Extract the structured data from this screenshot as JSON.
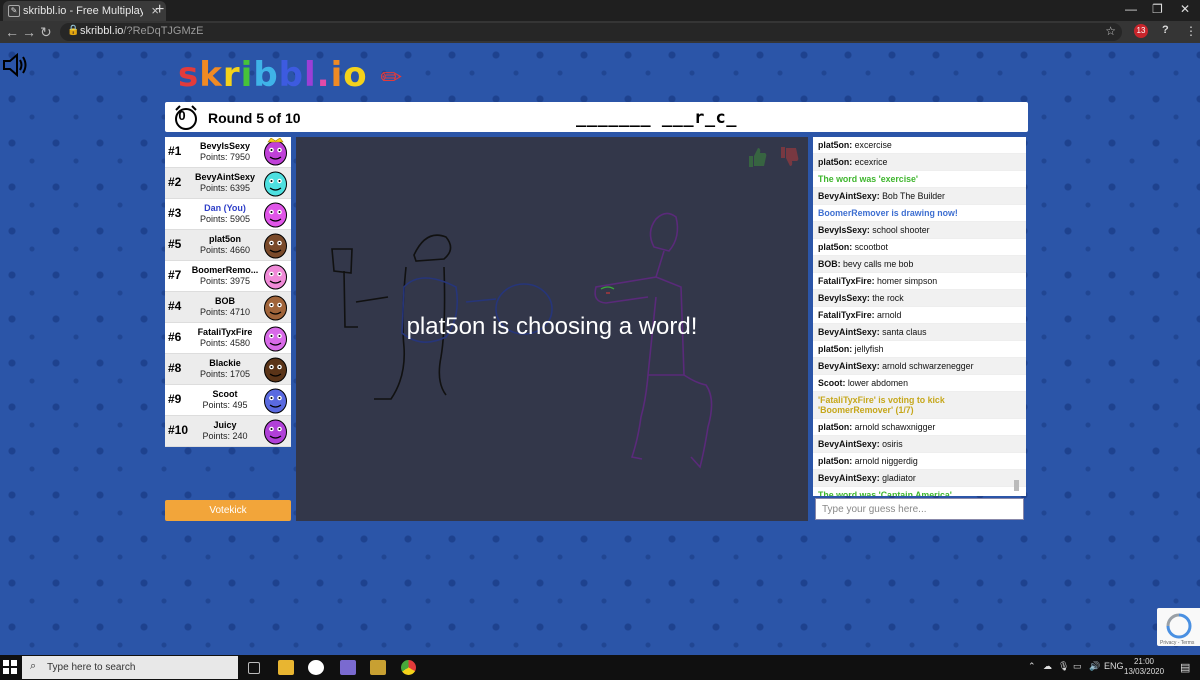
{
  "browser": {
    "tab_title": "skribbl.io - Free Multiplayer Drawi",
    "url_host": "skribbl.io",
    "url_path": "/?ReDqTJGMzE",
    "ext_badge": "13"
  },
  "game": {
    "logo": "skribbl.io",
    "timer": "0",
    "round": "Round 5 of 10",
    "hint": "_______ ___r_c_",
    "choosing": "plat5on is choosing a word!",
    "votekick_label": "Votekick",
    "guess_placeholder": "Type your guess here..."
  },
  "players": [
    {
      "rank": "#1",
      "name": "BevyIsSexy",
      "points": "Points: 7950",
      "you": false,
      "color": "#c040d8",
      "crown": true
    },
    {
      "rank": "#2",
      "name": "BevyAintSexy",
      "points": "Points: 6395",
      "you": false,
      "color": "#4de0e0",
      "crown": false
    },
    {
      "rank": "#3",
      "name": "Dan (You)",
      "points": "Points: 5905",
      "you": true,
      "color": "#e055e8",
      "crown": false
    },
    {
      "rank": "#5",
      "name": "plat5on",
      "points": "Points: 4660",
      "you": false,
      "color": "#7a4a2a",
      "crown": false
    },
    {
      "rank": "#7",
      "name": "BoomerRemo...",
      "points": "Points: 3975",
      "you": false,
      "color": "#f08ad8",
      "crown": false
    },
    {
      "rank": "#4",
      "name": "BOB",
      "points": "Points: 4710",
      "you": false,
      "color": "#a0643a",
      "crown": false
    },
    {
      "rank": "#6",
      "name": "FataliTyxFire",
      "points": "Points: 4580",
      "you": false,
      "color": "#d86ae8",
      "crown": false
    },
    {
      "rank": "#8",
      "name": "Blackie",
      "points": "Points: 1705",
      "you": false,
      "color": "#5a3418",
      "crown": false
    },
    {
      "rank": "#9",
      "name": "Scoot",
      "points": "Points: 495",
      "you": false,
      "color": "#5a6ae0",
      "crown": false
    },
    {
      "rank": "#10",
      "name": "Juicy",
      "points": "Points: 240",
      "you": false,
      "color": "#b040d8",
      "crown": false
    }
  ],
  "chat": [
    {
      "user": "plat5on",
      "text": "excercise",
      "type": "normal"
    },
    {
      "user": "plat5on",
      "text": "ecexrice",
      "type": "normal"
    },
    {
      "user": "",
      "text": "The word was 'exercise'",
      "type": "green"
    },
    {
      "user": "BevyAintSexy",
      "text": "Bob The Builder",
      "type": "normal"
    },
    {
      "user": "",
      "text": "BoomerRemover is drawing now!",
      "type": "blue"
    },
    {
      "user": "BevyIsSexy",
      "text": "school shooter",
      "type": "normal"
    },
    {
      "user": "plat5on",
      "text": "scootbot",
      "type": "normal"
    },
    {
      "user": "BOB",
      "text": "bevy calls me bob",
      "type": "normal"
    },
    {
      "user": "FataliTyxFire",
      "text": "homer simpson",
      "type": "normal"
    },
    {
      "user": "BevyIsSexy",
      "text": "the rock",
      "type": "normal"
    },
    {
      "user": "FataliTyxFire",
      "text": "arnold",
      "type": "normal"
    },
    {
      "user": "BevyAintSexy",
      "text": "santa claus",
      "type": "normal"
    },
    {
      "user": "plat5on",
      "text": "jellyfish",
      "type": "normal"
    },
    {
      "user": "BevyAintSexy",
      "text": "arnold schwarzenegger",
      "type": "normal"
    },
    {
      "user": "Scoot",
      "text": "lower abdomen",
      "type": "normal"
    },
    {
      "user": "",
      "text": "'FataliTyxFire' is voting to kick 'BoomerRemover' (1/7)",
      "type": "yellow"
    },
    {
      "user": "plat5on",
      "text": "arnold schawxnigger",
      "type": "normal"
    },
    {
      "user": "BevyAintSexy",
      "text": "osiris",
      "type": "normal"
    },
    {
      "user": "plat5on",
      "text": "arnold niggerdig",
      "type": "normal"
    },
    {
      "user": "BevyAintSexy",
      "text": "gladiator",
      "type": "normal"
    },
    {
      "user": "",
      "text": "The word was 'Captain America'",
      "type": "green"
    }
  ],
  "recaptcha": "Privacy - Terms",
  "taskbar": {
    "search_placeholder": "Type here to search",
    "lang": "ENG",
    "time": "21:00",
    "date": "13/03/2020"
  },
  "colors": {
    "background": "#2b55a8",
    "canvas": "#33374a",
    "votekick": "#f2a53a",
    "chat_green": "#3fb62e",
    "chat_blue": "#3e6fd1"
  }
}
